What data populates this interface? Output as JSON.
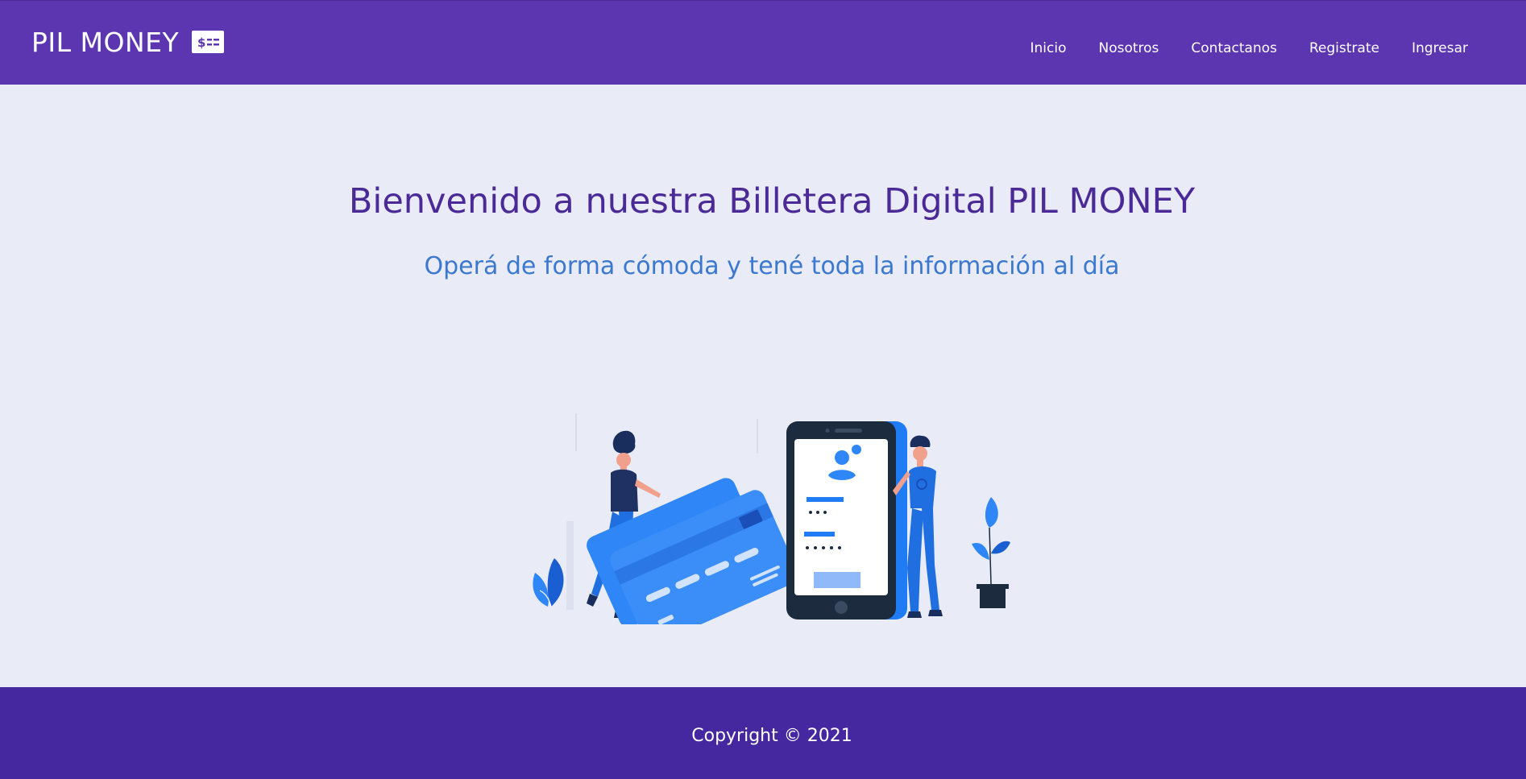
{
  "brand": {
    "name": "PIL MONEY",
    "icon": "money-bill-icon"
  },
  "nav": {
    "items": [
      {
        "label": "Inicio"
      },
      {
        "label": "Nosotros"
      },
      {
        "label": "Contactanos"
      },
      {
        "label": "Registrate"
      },
      {
        "label": "Ingresar"
      }
    ]
  },
  "hero": {
    "title": "Bienvenido a nuestra Billetera Digital PIL MONEY",
    "subtitle": "Operá de forma cómoda y tené toda la información al día"
  },
  "illustration": {
    "icon": "digital-wallet-illustration"
  },
  "footer": {
    "copyright": "Copyright © 2021"
  },
  "colors": {
    "navbar": "#5c35b0",
    "footer": "#4527a0",
    "background": "#e9ebf6",
    "title": "#4b2a97",
    "subtitle": "#3b78cf"
  }
}
